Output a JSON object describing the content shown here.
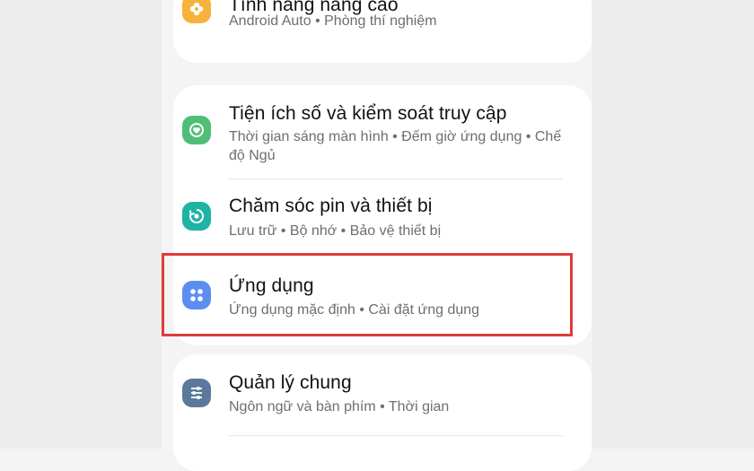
{
  "items": [
    {
      "title": "Tính năng nâng cao",
      "subtitle": "Android Auto  •  Phòng thí nghiệm",
      "icon": "advanced-features-icon",
      "color": "#f6b23a"
    },
    {
      "title": "Tiện ích số và kiểm soát truy cập",
      "subtitle": "Thời gian sáng màn hình  •  Đếm giờ ứng dụng  •  Chế độ Ngủ",
      "icon": "digital-wellbeing-icon",
      "color": "#4fbf78"
    },
    {
      "title": "Chăm sóc pin và thiết bị",
      "subtitle": "Lưu trữ  •  Bộ nhớ  •  Bảo vệ thiết bị",
      "icon": "device-care-icon",
      "color": "#1fb3a3"
    },
    {
      "title": "Ứng dụng",
      "subtitle": "Ứng dụng mặc định  •  Cài đặt ứng dụng",
      "icon": "apps-icon",
      "color": "#5c8ef2"
    },
    {
      "title": "Quản lý chung",
      "subtitle": "Ngôn ngữ và bàn phím  •  Thời gian",
      "icon": "general-management-icon",
      "color": "#5b7a9b"
    }
  ],
  "highlight_color": "#e03b3b"
}
